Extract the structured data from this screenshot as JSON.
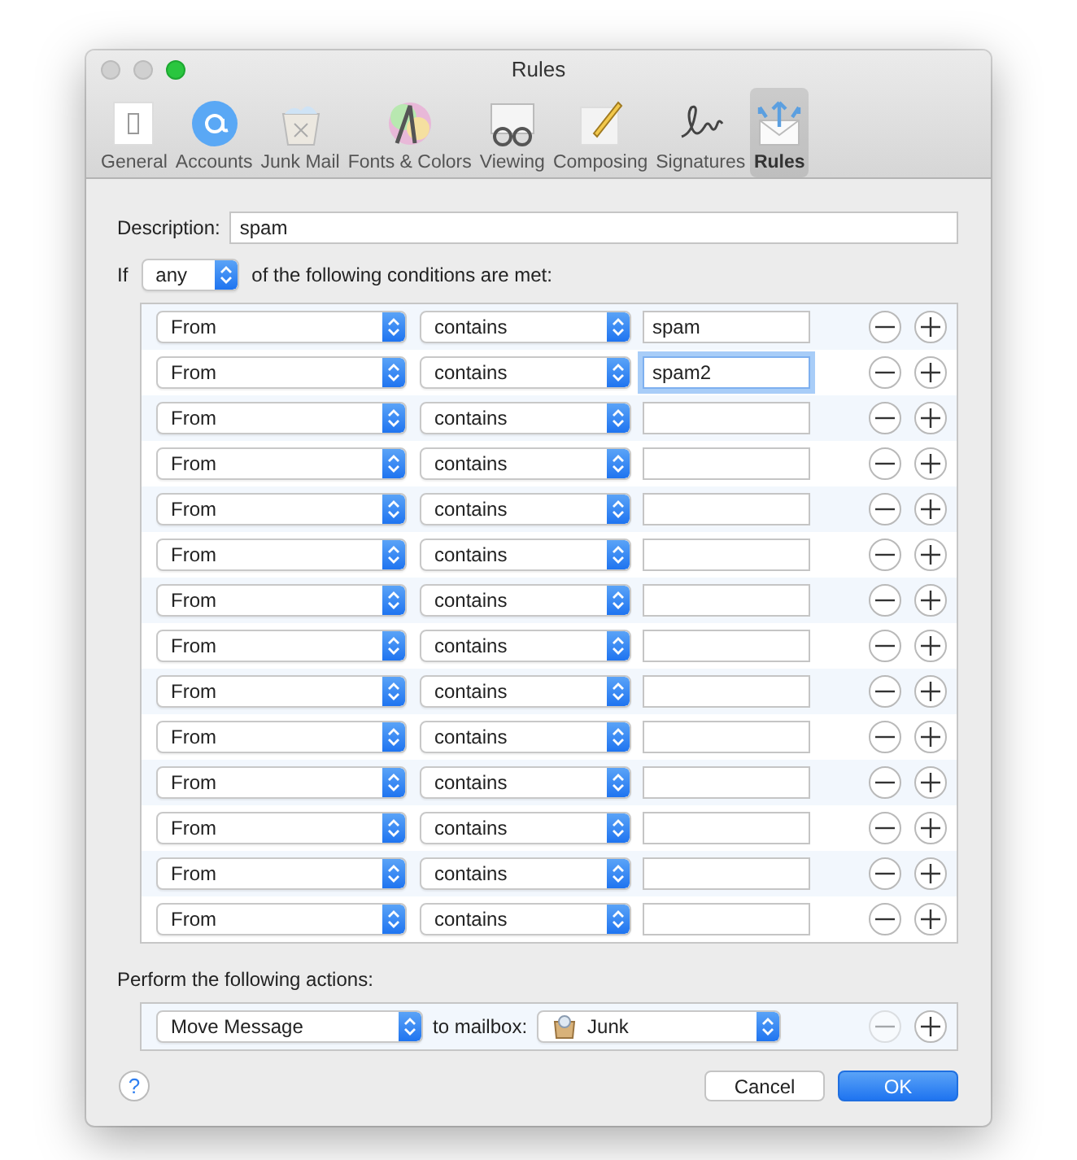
{
  "window": {
    "title": "Rules"
  },
  "toolbar": [
    {
      "label": "General",
      "selected": false
    },
    {
      "label": "Accounts",
      "selected": false
    },
    {
      "label": "Junk Mail",
      "selected": false
    },
    {
      "label": "Fonts & Colors",
      "selected": false
    },
    {
      "label": "Viewing",
      "selected": false
    },
    {
      "label": "Composing",
      "selected": false
    },
    {
      "label": "Signatures",
      "selected": false
    },
    {
      "label": "Rules",
      "selected": true
    }
  ],
  "description": {
    "label": "Description:",
    "value": "spam"
  },
  "match": {
    "prefix": "If",
    "value": "any",
    "suffix": "of the following conditions are met:"
  },
  "conditions": [
    {
      "field": "From",
      "operator": "contains",
      "value": "spam",
      "focused": false
    },
    {
      "field": "From",
      "operator": "contains",
      "value": "spam2",
      "focused": true
    },
    {
      "field": "From",
      "operator": "contains",
      "focused": false
    },
    {
      "field": "From",
      "operator": "contains",
      "focused": false
    },
    {
      "field": "From",
      "operator": "contains",
      "focused": false
    },
    {
      "field": "From",
      "operator": "contains",
      "focused": false
    },
    {
      "field": "From",
      "operator": "contains",
      "focused": false
    },
    {
      "field": "From",
      "operator": "contains",
      "focused": false
    },
    {
      "field": "From",
      "operator": "contains",
      "focused": false
    },
    {
      "field": "From",
      "operator": "contains",
      "focused": false
    },
    {
      "field": "From",
      "operator": "contains",
      "focused": false
    },
    {
      "field": "From",
      "operator": "contains",
      "focused": false
    },
    {
      "field": "From",
      "operator": "contains",
      "focused": false
    },
    {
      "field": "From",
      "operator": "contains",
      "focused": false
    }
  ],
  "actions_label": "Perform the following actions:",
  "actions": [
    {
      "action": "Move Message",
      "connector": "to mailbox:",
      "mailbox": "Junk",
      "remove_disabled": true
    }
  ],
  "help": "?",
  "buttons": [
    {
      "label": "Cancel",
      "default": false
    },
    {
      "label": "OK",
      "default": true
    }
  ]
}
